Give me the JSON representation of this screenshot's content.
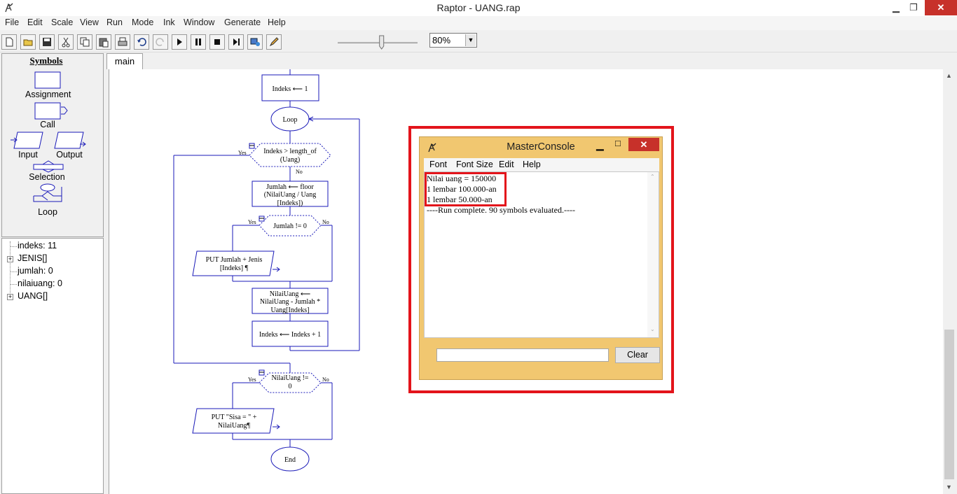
{
  "window": {
    "title": "Raptor - UANG.rap",
    "min_icon": "minimize-icon",
    "max_icon": "restore-icon",
    "close_icon": "close-icon"
  },
  "menu": [
    "File",
    "Edit",
    "Scale",
    "View",
    "Run",
    "Mode",
    "Ink",
    "Window",
    "Generate",
    "Help"
  ],
  "toolbar": {
    "icons": [
      "new-file-icon",
      "open-folder-icon",
      "save-icon",
      "cut-icon",
      "copy-icon",
      "paste-icon",
      "print-icon",
      "undo-icon",
      "redo-icon",
      "play-icon",
      "pause-icon",
      "stop-icon",
      "step-icon",
      "test-server-icon",
      "pen-icon"
    ],
    "speed": 0.55,
    "zoom": "80%"
  },
  "symbols": {
    "title": "Symbols",
    "items": [
      "Assignment",
      "Call",
      "Input",
      "Output",
      "Selection",
      "Loop"
    ]
  },
  "variables": [
    {
      "label": "indeks: 11",
      "expandable": false
    },
    {
      "label": "JENIS[]",
      "expandable": true
    },
    {
      "label": "jumlah: 0",
      "expandable": false
    },
    {
      "label": "nilaiuang: 0",
      "expandable": false
    },
    {
      "label": "UANG[]",
      "expandable": true
    }
  ],
  "tabs": [
    {
      "label": "main"
    }
  ],
  "flowchart": {
    "assign_init": "Indeks ⟵ 1",
    "loop_label": "Loop",
    "loop_cond_1": "Indeks > length_of",
    "loop_cond_2": "(Uang)",
    "yes": "Yes",
    "no": "No",
    "assign_jumlah_1": "Jumlah ⟵ floor",
    "assign_jumlah_2": "(NilaiUang / Uang",
    "assign_jumlah_3": "[Indeks])",
    "sel1_cond": "Jumlah != 0",
    "put1_1": "PUT Jumlah + Jenis",
    "put1_2": "[Indeks] ¶",
    "assign_nilai_1": "NilaiUang ⟵",
    "assign_nilai_2": "NilaiUang - Jumlah *",
    "assign_nilai_3": "Uang[Indeks]",
    "assign_inc": "Indeks ⟵ Indeks + 1",
    "sel2_cond_1": "NilaiUang !=",
    "sel2_cond_2": "0",
    "put2_1": "PUT \"Sisa = \" +",
    "put2_2": "NilaiUang¶",
    "end_label": "End"
  },
  "console": {
    "title": "MasterConsole",
    "menu": [
      "Font",
      "Font Size",
      "Edit",
      "Help"
    ],
    "output": [
      "Nilai uang = 150000",
      "1 lembar 100.000-an",
      "1 lembar 50.000-an",
      "----Run complete.  90 symbols evaluated.----"
    ],
    "input_value": "",
    "clear_label": "Clear"
  }
}
